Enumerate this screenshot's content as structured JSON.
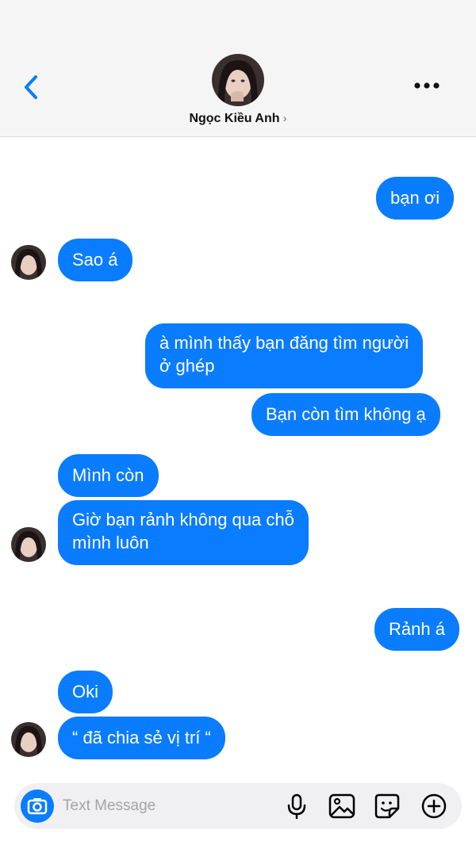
{
  "header": {
    "contact_name": "Ngọc Kiều Anh",
    "chevron": "›",
    "back_icon": "chevron-left-icon",
    "more_icon": "more-horizontal-icon"
  },
  "messages": [
    {
      "from": "me",
      "text": "bạn ơi"
    },
    {
      "from": "them",
      "text": "Sao á"
    },
    {
      "from": "me",
      "lines": [
        "à mình thấy bạn đăng tìm người",
        "ở ghép"
      ]
    },
    {
      "from": "me",
      "text": "Bạn còn tìm không ạ"
    },
    {
      "from": "them",
      "text": "Mình còn"
    },
    {
      "from": "them",
      "lines": [
        "Giờ bạn rảnh không qua chỗ",
        "mình luôn"
      ]
    },
    {
      "from": "me",
      "text": "Rảnh á"
    },
    {
      "from": "them",
      "text": "Oki"
    },
    {
      "from": "them",
      "text": "“ đã chia sẻ vị trí “"
    }
  ],
  "composer": {
    "placeholder": "Text Message",
    "icons": [
      "camera-icon",
      "microphone-icon",
      "image-icon",
      "sticker-icon",
      "plus-icon"
    ]
  },
  "colors": {
    "bubble": "#0a7cff",
    "header_bg": "#f5f5f5",
    "accent": "#0a7cff"
  }
}
